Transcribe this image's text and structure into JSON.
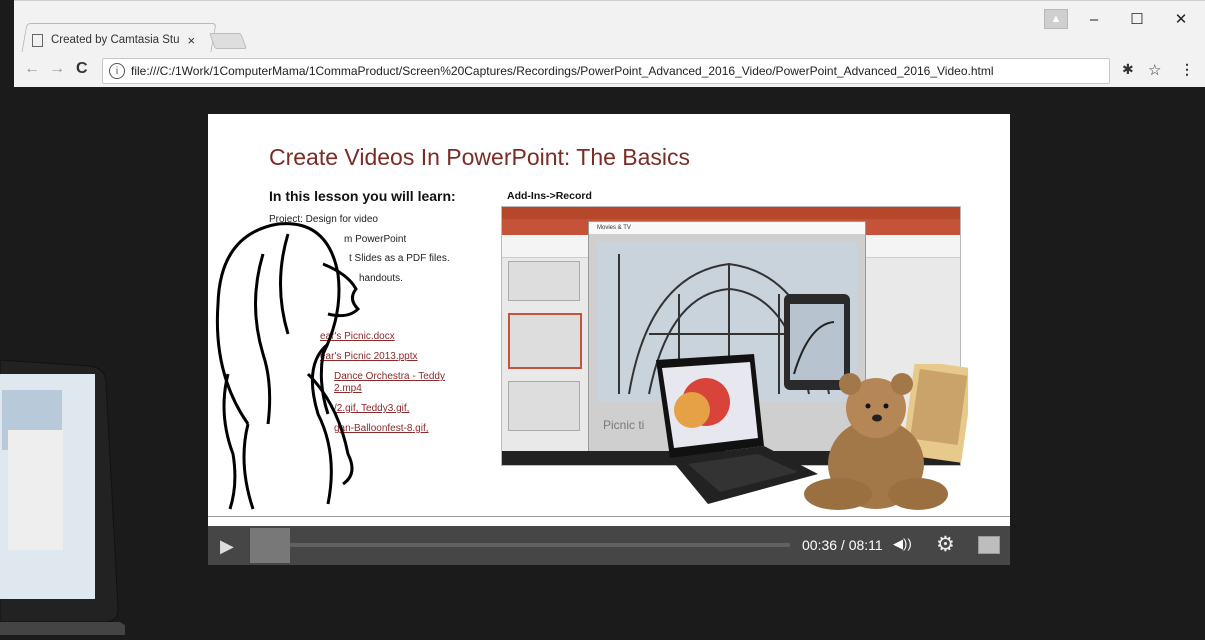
{
  "browser": {
    "tab_title": "Created by Camtasia Stu",
    "close_tab": "×",
    "url": "file:///C:/1Work/1ComputerMama/1CommaProduct/Screen%20Captures/Recordings/PowerPoint_Advanced_2016_Video/PowerPoint_Advanced_2016_Video.html",
    "back": "←",
    "forward": "→",
    "reload": "C",
    "star": "☆",
    "menu": "⋮",
    "minimize": "–",
    "maximize": "☐",
    "close": "✕"
  },
  "slide": {
    "title": "Create Videos In PowerPoint: The Basics",
    "lesson_heading": "In this lesson you will learn:",
    "lesson_lines": [
      "Project: Design for video",
      "m PowerPoint",
      "t Slides as a PDF files.",
      "handouts."
    ],
    "links": [
      "ear's Picnic.docx",
      "ear's Picnic 2013.pptx",
      "Dance Orchestra - Teddy",
      "2.mp4",
      "/2.gif, Teddy3.gif,",
      "gan-Balloonfest-8.gif,"
    ],
    "addins_label": "Add-Ins->Record",
    "movie_window_title": "Movies & TV",
    "movie_caption": "Picnic ti"
  },
  "player": {
    "play": "▶",
    "time": "00:36 / 08:11",
    "volume": "◀))",
    "settings": "⚙"
  }
}
